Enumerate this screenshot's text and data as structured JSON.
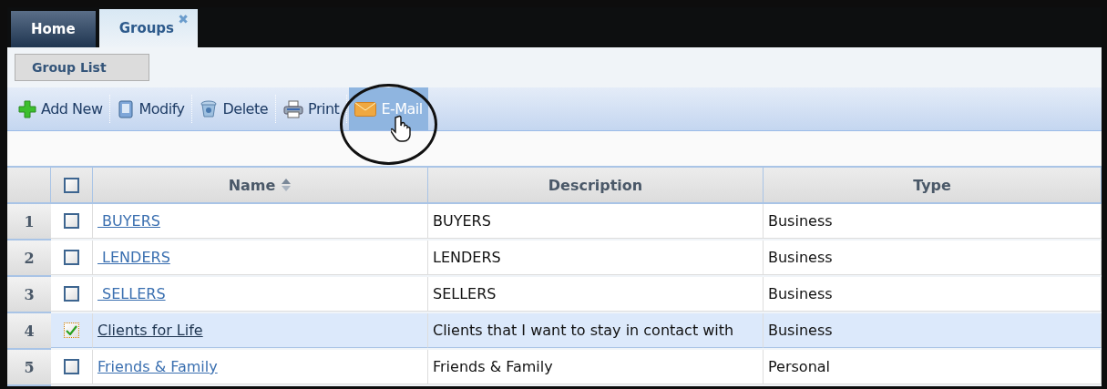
{
  "tabs": [
    {
      "label": "Home",
      "selected": false
    },
    {
      "label": "Groups",
      "selected": true,
      "close": "✖"
    }
  ],
  "subtab": {
    "label": "Group List"
  },
  "toolbar": [
    {
      "label": "Add New",
      "highlighted": false
    },
    {
      "label": "Modify",
      "highlighted": false
    },
    {
      "label": "Delete",
      "highlighted": false
    },
    {
      "label": "Print",
      "highlighted": false
    },
    {
      "label": "E-Mail",
      "highlighted": true
    }
  ],
  "table": {
    "select_all": {
      "checked": false
    },
    "columns": [
      {
        "label": "Name",
        "sorted": true
      },
      {
        "label": "Description",
        "sorted": false
      },
      {
        "label": "Type",
        "sorted": false
      }
    ],
    "rows": [
      {
        "number": "1",
        "checked": false,
        "selected": false,
        "name": " BUYERS",
        "description": "BUYERS",
        "type": "Business"
      },
      {
        "number": "2",
        "checked": false,
        "selected": false,
        "name": " LENDERS",
        "description": "LENDERS",
        "type": "Business"
      },
      {
        "number": "3",
        "checked": false,
        "selected": false,
        "name": " SELLERS",
        "description": "SELLERS",
        "type": "Business"
      },
      {
        "number": "4",
        "checked": true,
        "selected": true,
        "name": "Clients for Life",
        "description": "Clients that I want to stay in contact with",
        "type": "Business"
      },
      {
        "number": "5",
        "checked": false,
        "selected": false,
        "name": "Friends & Family",
        "description": "Friends & Family",
        "type": "Personal"
      }
    ]
  }
}
